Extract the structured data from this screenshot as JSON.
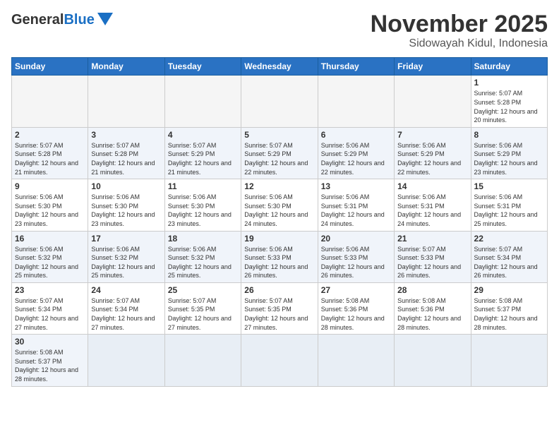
{
  "title": "November 2025",
  "subtitle": "Sidowayah Kidul, Indonesia",
  "logo": {
    "general": "General",
    "blue": "Blue"
  },
  "weekdays": [
    "Sunday",
    "Monday",
    "Tuesday",
    "Wednesday",
    "Thursday",
    "Friday",
    "Saturday"
  ],
  "days": {
    "1": {
      "sunrise": "5:07 AM",
      "sunset": "5:28 PM",
      "daylight": "12 hours and 20 minutes."
    },
    "2": {
      "sunrise": "5:07 AM",
      "sunset": "5:28 PM",
      "daylight": "12 hours and 21 minutes."
    },
    "3": {
      "sunrise": "5:07 AM",
      "sunset": "5:28 PM",
      "daylight": "12 hours and 21 minutes."
    },
    "4": {
      "sunrise": "5:07 AM",
      "sunset": "5:29 PM",
      "daylight": "12 hours and 21 minutes."
    },
    "5": {
      "sunrise": "5:07 AM",
      "sunset": "5:29 PM",
      "daylight": "12 hours and 22 minutes."
    },
    "6": {
      "sunrise": "5:06 AM",
      "sunset": "5:29 PM",
      "daylight": "12 hours and 22 minutes."
    },
    "7": {
      "sunrise": "5:06 AM",
      "sunset": "5:29 PM",
      "daylight": "12 hours and 22 minutes."
    },
    "8": {
      "sunrise": "5:06 AM",
      "sunset": "5:29 PM",
      "daylight": "12 hours and 23 minutes."
    },
    "9": {
      "sunrise": "5:06 AM",
      "sunset": "5:30 PM",
      "daylight": "12 hours and 23 minutes."
    },
    "10": {
      "sunrise": "5:06 AM",
      "sunset": "5:30 PM",
      "daylight": "12 hours and 23 minutes."
    },
    "11": {
      "sunrise": "5:06 AM",
      "sunset": "5:30 PM",
      "daylight": "12 hours and 23 minutes."
    },
    "12": {
      "sunrise": "5:06 AM",
      "sunset": "5:30 PM",
      "daylight": "12 hours and 24 minutes."
    },
    "13": {
      "sunrise": "5:06 AM",
      "sunset": "5:31 PM",
      "daylight": "12 hours and 24 minutes."
    },
    "14": {
      "sunrise": "5:06 AM",
      "sunset": "5:31 PM",
      "daylight": "12 hours and 24 minutes."
    },
    "15": {
      "sunrise": "5:06 AM",
      "sunset": "5:31 PM",
      "daylight": "12 hours and 25 minutes."
    },
    "16": {
      "sunrise": "5:06 AM",
      "sunset": "5:32 PM",
      "daylight": "12 hours and 25 minutes."
    },
    "17": {
      "sunrise": "5:06 AM",
      "sunset": "5:32 PM",
      "daylight": "12 hours and 25 minutes."
    },
    "18": {
      "sunrise": "5:06 AM",
      "sunset": "5:32 PM",
      "daylight": "12 hours and 25 minutes."
    },
    "19": {
      "sunrise": "5:06 AM",
      "sunset": "5:33 PM",
      "daylight": "12 hours and 26 minutes."
    },
    "20": {
      "sunrise": "5:06 AM",
      "sunset": "5:33 PM",
      "daylight": "12 hours and 26 minutes."
    },
    "21": {
      "sunrise": "5:07 AM",
      "sunset": "5:33 PM",
      "daylight": "12 hours and 26 minutes."
    },
    "22": {
      "sunrise": "5:07 AM",
      "sunset": "5:34 PM",
      "daylight": "12 hours and 26 minutes."
    },
    "23": {
      "sunrise": "5:07 AM",
      "sunset": "5:34 PM",
      "daylight": "12 hours and 27 minutes."
    },
    "24": {
      "sunrise": "5:07 AM",
      "sunset": "5:34 PM",
      "daylight": "12 hours and 27 minutes."
    },
    "25": {
      "sunrise": "5:07 AM",
      "sunset": "5:35 PM",
      "daylight": "12 hours and 27 minutes."
    },
    "26": {
      "sunrise": "5:07 AM",
      "sunset": "5:35 PM",
      "daylight": "12 hours and 27 minutes."
    },
    "27": {
      "sunrise": "5:08 AM",
      "sunset": "5:36 PM",
      "daylight": "12 hours and 28 minutes."
    },
    "28": {
      "sunrise": "5:08 AM",
      "sunset": "5:36 PM",
      "daylight": "12 hours and 28 minutes."
    },
    "29": {
      "sunrise": "5:08 AM",
      "sunset": "5:37 PM",
      "daylight": "12 hours and 28 minutes."
    },
    "30": {
      "sunrise": "5:08 AM",
      "sunset": "5:37 PM",
      "daylight": "12 hours and 28 minutes."
    }
  },
  "labels": {
    "sunrise": "Sunrise:",
    "sunset": "Sunset:",
    "daylight": "Daylight:"
  }
}
